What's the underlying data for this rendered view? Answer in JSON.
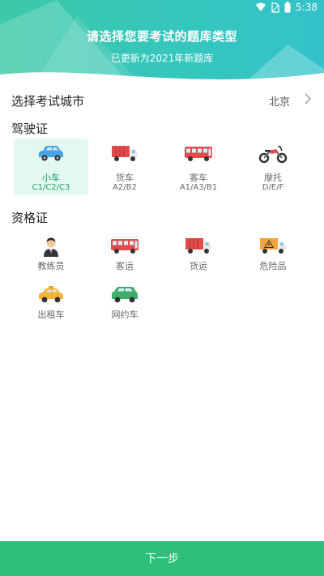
{
  "status": {
    "time": "5:38"
  },
  "header": {
    "title": "请选择您要考试的题库类型",
    "subtitle": "已更新为2021年新题库"
  },
  "city": {
    "label": "选择考试城市",
    "value": "北京"
  },
  "license": {
    "title": "驾驶证",
    "items": [
      {
        "label": "小车",
        "sub": "C1/C2/C3",
        "icon": "car-icon",
        "selected": true
      },
      {
        "label": "货车",
        "sub": "A2/B2",
        "icon": "truck-icon",
        "selected": false
      },
      {
        "label": "客车",
        "sub": "A1/A3/B1",
        "icon": "bus-icon",
        "selected": false
      },
      {
        "label": "摩托",
        "sub": "D/E/F",
        "icon": "motorcycle-icon",
        "selected": false
      }
    ]
  },
  "qualification": {
    "title": "资格证",
    "items": [
      {
        "label": "教练员",
        "icon": "coach-person-icon"
      },
      {
        "label": "客运",
        "icon": "passenger-bus-icon"
      },
      {
        "label": "货运",
        "icon": "freight-truck-icon"
      },
      {
        "label": "危险品",
        "icon": "hazard-truck-icon"
      },
      {
        "label": "出租车",
        "icon": "taxi-icon"
      },
      {
        "label": "网约车",
        "icon": "ride-hailing-car-icon"
      }
    ]
  },
  "footer": {
    "next_label": "下一步"
  },
  "colors": {
    "header_gradient": "#3dc9a6",
    "accent": "#2dbe7a",
    "selected_bg": "#e3f8ee",
    "selected_text": "#1aa06a"
  }
}
